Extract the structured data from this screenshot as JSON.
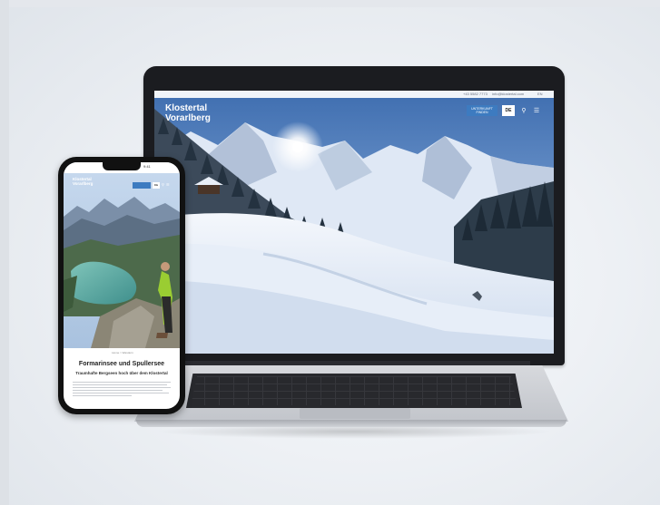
{
  "laptop": {
    "topbar": {
      "phone": "+43 5582 7773",
      "email": "info@klostertal.com",
      "extra": "EN"
    },
    "logo": {
      "line1": "Klostertal",
      "line2": "Vorarlberg"
    },
    "cta_label": "UNTERKUNFT FINDEN",
    "lang_label": "DE",
    "icons": [
      "search-icon",
      "menu-icon"
    ]
  },
  "phone": {
    "status_time": "9:41",
    "logo": {
      "line1": "Klostertal",
      "line2": "Vorarlberg"
    },
    "lang_label": "DE",
    "breadcrumb": "Home > Wandern",
    "title": "Formarinsee und Spullersee",
    "subtitle": "Traumhafte Bergseen hoch über dem Klostertal"
  },
  "colors": {
    "accent": "#3d7bc0",
    "sky": "#5a7fb6",
    "snow": "#eef3fa",
    "lake": "#5ea9a1"
  }
}
